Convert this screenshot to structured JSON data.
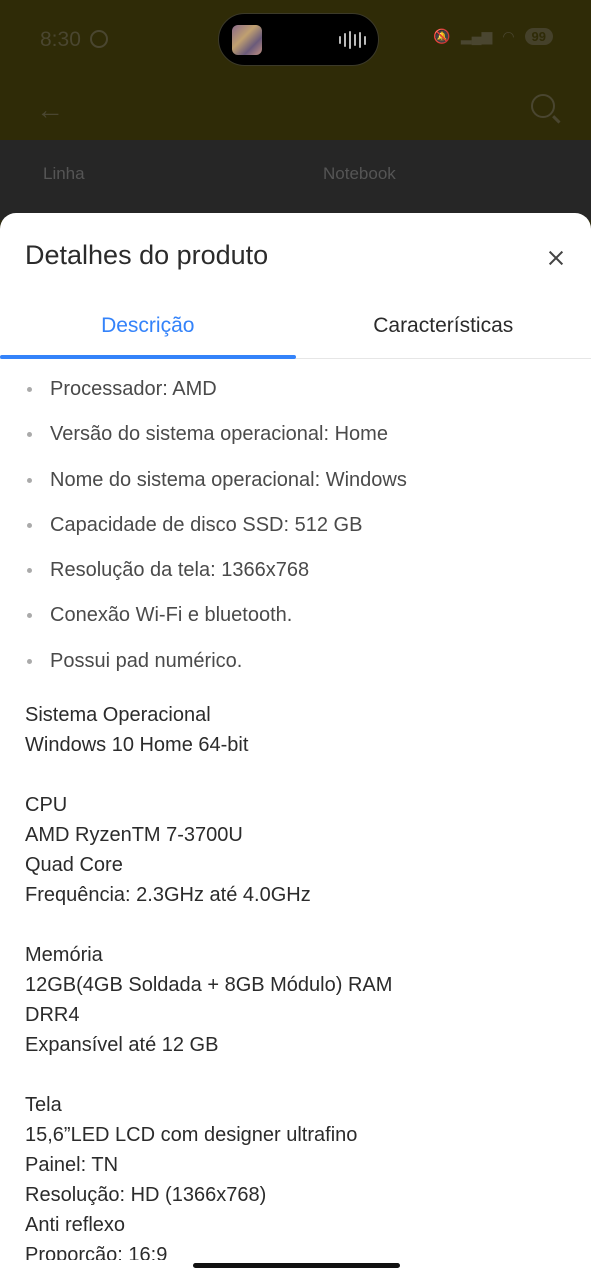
{
  "status_bar": {
    "time": "8:30",
    "battery": "99"
  },
  "background": {
    "row_label": "Linha",
    "row_value": "Notebook"
  },
  "sheet": {
    "title": "Detalhes do produto",
    "tabs": [
      {
        "label": "Descrição",
        "active": true
      },
      {
        "label": "Características",
        "active": false
      }
    ],
    "bullets": [
      "Processador: AMD",
      "Versão do sistema operacional: Home",
      "Nome do sistema operacional: Windows",
      "Capacidade de disco SSD: 512 GB",
      "Resolução da tela: 1366x768",
      "Conexão Wi-Fi e bluetooth.",
      "Possui pad numérico."
    ],
    "specs": [
      {
        "lines": [
          "Sistema Operacional",
          "Windows 10 Home 64-bit"
        ]
      },
      {
        "lines": [
          "CPU",
          "AMD RyzenTM 7-3700U",
          "Quad Core",
          "Frequência: 2.3GHz até 4.0GHz"
        ]
      },
      {
        "lines": [
          "Memória",
          "12GB(4GB Soldada + 8GB Módulo) RAM",
          "DRR4",
          "Expansível até 12 GB"
        ]
      },
      {
        "lines": [
          "Tela",
          "15,6”LED LCD com designer ultrafino",
          "Painel: TN",
          "Resolução: HD (1366x768)",
          "Anti reflexo",
          "Proporção: 16:9"
        ]
      }
    ]
  },
  "colors": {
    "accent": "#3483fa",
    "background_dim": "#2f2b07"
  }
}
